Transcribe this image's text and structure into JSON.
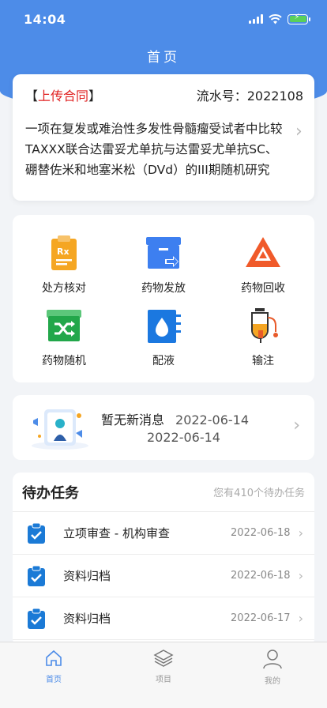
{
  "status_bar": {
    "time": "14:04"
  },
  "header": {
    "title": "首页"
  },
  "contract": {
    "tag": "上传合同",
    "serial_label": "流水号：",
    "serial_no": "2022108",
    "title": "一项在复发或难治性多发性骨髓瘤受试者中比较TAXXX联合达雷妥尤单抗与达雷妥尤单抗SC、硼替佐米和地塞米松（DVd）的III期随机研究"
  },
  "functions": [
    {
      "label": "处方核对",
      "icon": "prescription-icon",
      "color": "#f5a623"
    },
    {
      "label": "药物发放",
      "icon": "drug-dispense-icon",
      "color": "#3d7ff0"
    },
    {
      "label": "药物回收",
      "icon": "drug-recycle-icon",
      "color": "#f05a2a"
    },
    {
      "label": "药物随机",
      "icon": "shuffle-icon",
      "color": "#22a74a"
    },
    {
      "label": "配液",
      "icon": "liquid-icon",
      "color": "#1b78e0"
    },
    {
      "label": "输注",
      "icon": "infusion-icon",
      "color": "#e85a2a"
    }
  ],
  "message": {
    "text": "暂无新消息",
    "date1": "2022-06-14",
    "date2": "2022-06-14"
  },
  "todo": {
    "title": "待办任务",
    "count_text": "您有410个待办任务",
    "items": [
      {
        "name": "立项审查 - 机构审查",
        "date": "2022-06-18"
      },
      {
        "name": "资料归档",
        "date": "2022-06-18"
      },
      {
        "name": "资料归档",
        "date": "2022-06-17"
      }
    ]
  },
  "tabs": [
    {
      "label": "首页",
      "icon": "home-icon",
      "active": true
    },
    {
      "label": "项目",
      "icon": "layers-icon",
      "active": false
    },
    {
      "label": "我的",
      "icon": "user-icon",
      "active": false
    }
  ],
  "colors": {
    "primary": "#4d8ce8",
    "accent_red": "#e02020"
  }
}
